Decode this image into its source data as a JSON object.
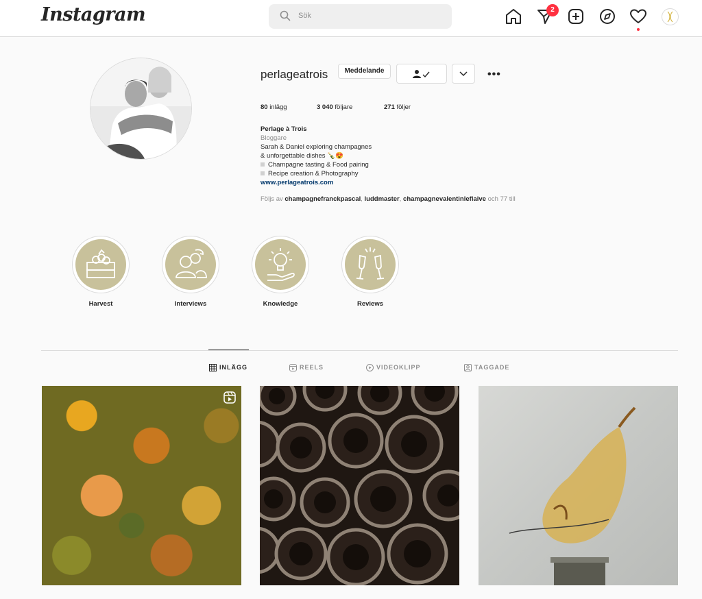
{
  "nav": {
    "logo": "Instagram",
    "search_placeholder": "Sök",
    "notification_count": "2",
    "icons": [
      "home-icon",
      "direct-icon",
      "new-post-icon",
      "explore-icon",
      "activity-icon",
      "profile-avatar"
    ]
  },
  "profile": {
    "username": "perlageatrois",
    "message_button": "Meddelande",
    "stats": {
      "posts_value": "80",
      "posts_label": "inlägg",
      "followers_value": "3 040",
      "followers_label": "följare",
      "following_value": "271",
      "following_label": "följer"
    },
    "bio": {
      "name": "Perlage à Trois",
      "category": "Bloggare",
      "line1": "Sarah & Daniel exploring champagnes",
      "line2": "& unforgettable dishes 🍾😍",
      "line3": "Champagne tasting & Food pairing",
      "line4": "Recipe creation & Photography",
      "website": "www.perlageatrois.com"
    },
    "followed_by": {
      "prefix": "Följs av",
      "user1": "champagnefranckpascal",
      "user2": "luddmaster",
      "user3": "champagnevalentinleflaive",
      "suffix": "och 77 till"
    }
  },
  "highlights": [
    {
      "label": "Harvest",
      "icon": "crate-icon"
    },
    {
      "label": "Interviews",
      "icon": "people-icon"
    },
    {
      "label": "Knowledge",
      "icon": "lightbulb-icon"
    },
    {
      "label": "Reviews",
      "icon": "cheers-icon"
    }
  ],
  "tabs": [
    {
      "label": "INLÄGG",
      "active": true
    },
    {
      "label": "REELS",
      "active": false
    },
    {
      "label": "VIDEOKLIPP",
      "active": false
    },
    {
      "label": "TAGGADE",
      "active": false
    }
  ],
  "posts": [
    {
      "name": "autumn-forest-reel",
      "is_reel": true
    },
    {
      "name": "champagne-bottles-cellar",
      "is_reel": false
    },
    {
      "name": "dried-pear-slice",
      "is_reel": false
    }
  ],
  "colors": {
    "highlight_bg": "#c8c19b",
    "badge": "#ff3040",
    "link": "#00376b"
  }
}
